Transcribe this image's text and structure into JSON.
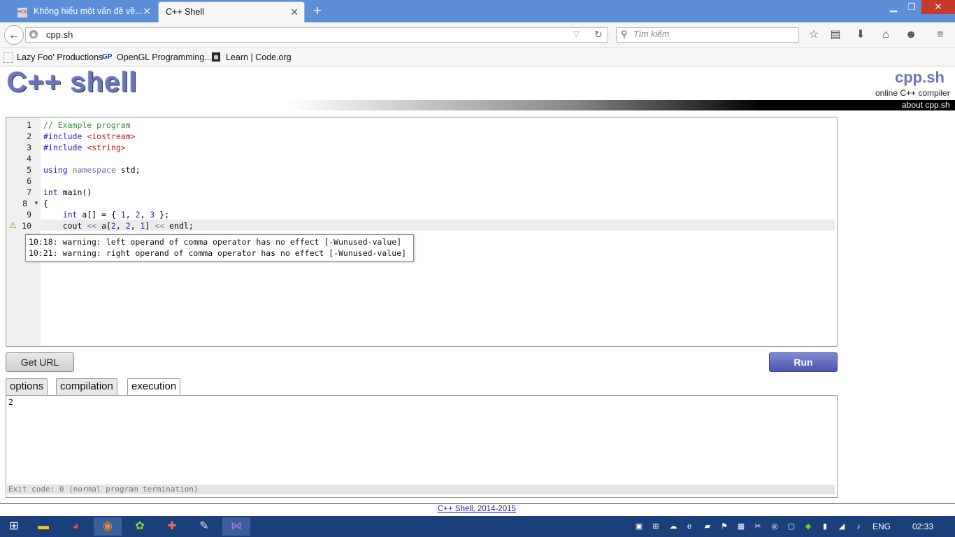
{
  "browser": {
    "tabs": [
      {
        "title": "Không hiểu một vấn đề về...",
        "active": false
      },
      {
        "title": "C++ Shell",
        "active": true
      }
    ],
    "url": "cpp.sh",
    "search_placeholder": "Tìm kiếm",
    "bookmarks": [
      {
        "label": "Lazy Foo' Productions"
      },
      {
        "label": "OpenGL Programming..."
      },
      {
        "label": "Learn | Code.org"
      }
    ]
  },
  "site": {
    "logo": "C++ shell",
    "brand": "cpp.sh",
    "tagline": "online C++ compiler",
    "about_link": "about cpp.sh"
  },
  "editor": {
    "line_numbers": [
      "1",
      "2",
      "3",
      "4",
      "5",
      "6",
      "7",
      "8",
      "9",
      "10",
      "1",
      "1"
    ],
    "lines": [
      "// Example program",
      "#include <iostream>",
      "#include <string>",
      "",
      "using namespace std;",
      "",
      "int main()",
      "{",
      "    int a[] = { 1, 2, 3 };",
      "    cout << a[2, 2, 1] << endl;"
    ],
    "tooltip": [
      "10:18: warning: left operand of comma operator has no effect [-Wunused-value]",
      "10:21: warning: right operand of comma operator has no effect [-Wunused-value]"
    ]
  },
  "buttons": {
    "get_url": "Get URL",
    "run": "Run"
  },
  "output_tabs": [
    {
      "label": "options",
      "selected": false
    },
    {
      "label": "compilation",
      "selected": false
    },
    {
      "label": "execution",
      "selected": true
    }
  ],
  "output": {
    "text": "2",
    "exit": "Exit code: 0 (normal program termination)"
  },
  "footer": "C++ Shell, 2014-2015",
  "taskbar": {
    "language": "ENG",
    "clock": "02:33"
  },
  "colors": {
    "tab_strip": "#5c8fd8",
    "logo": "#6a74b8",
    "run_button": "#4c56b0",
    "taskbar": "#1b3f7a"
  }
}
